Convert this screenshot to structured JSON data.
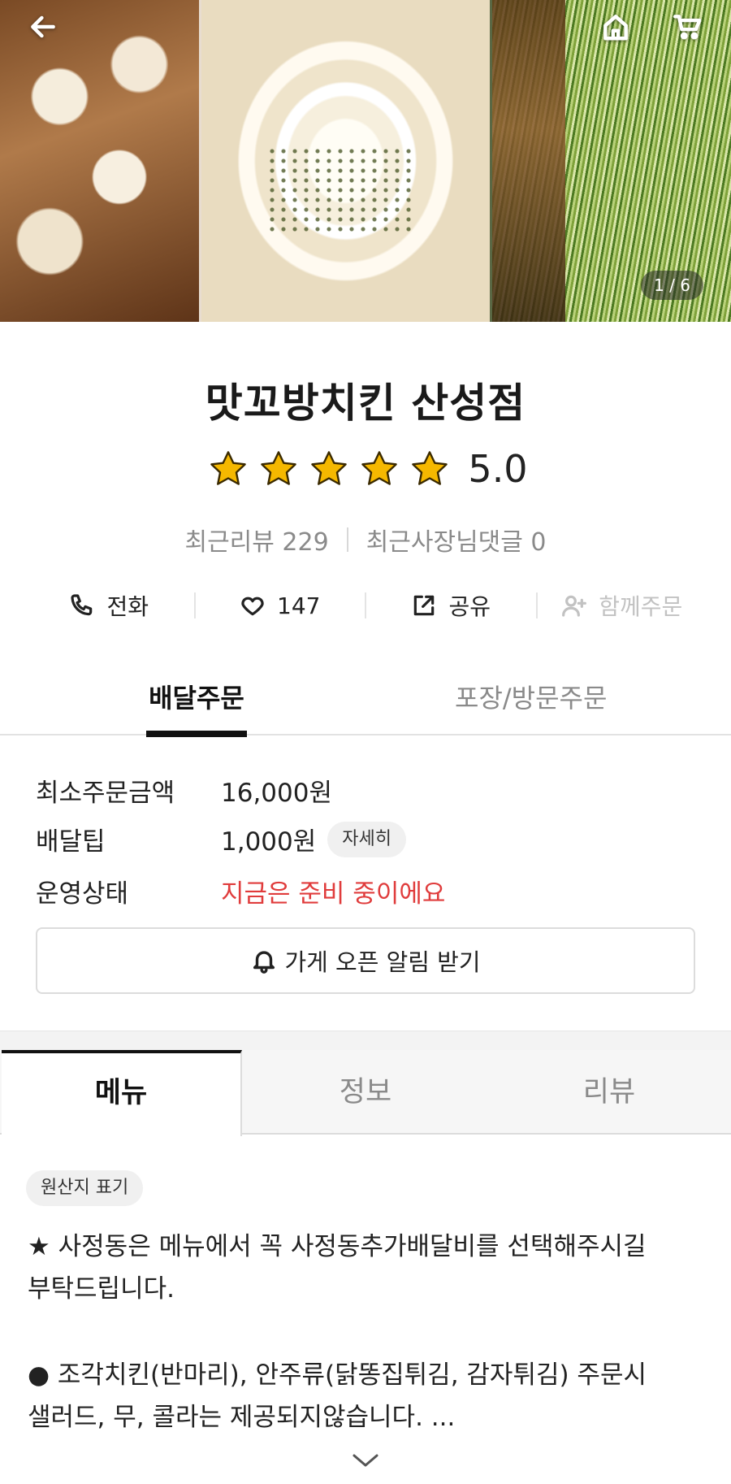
{
  "hero": {
    "image_counter": "1 / 6",
    "back_icon": "arrow-left-icon",
    "home_icon": "home-icon",
    "cart_icon": "cart-icon"
  },
  "store": {
    "name": "맛꼬방치킨 산성점",
    "rating": "5.0",
    "stars": 5,
    "star_color": "#f5b800",
    "recent_reviews": "최근리뷰 229",
    "recent_owner_replies": "최근사장님댓글 0"
  },
  "actions": {
    "call": "전화",
    "like_count": "147",
    "share": "공유",
    "group_order": "함께주문"
  },
  "order_tabs": {
    "delivery": "배달주문",
    "pickup": "포장/방문주문"
  },
  "delivery_info": {
    "min_order_label": "최소주문금액",
    "min_order_value": "16,000원",
    "tip_label": "배달팁",
    "tip_value": "1,000원",
    "tip_detail": "자세히",
    "status_label": "운영상태",
    "status_value": "지금은 준비 중이에요",
    "status_color": "#e03c3c",
    "notify_button": "가게 오픈 알림 받기"
  },
  "content_tabs": {
    "menu": "메뉴",
    "info": "정보",
    "review": "리뷰"
  },
  "notice": {
    "origin_chip": "원산지 표기",
    "line1": "★ 사정동은 메뉴에서 꼭 사정동추가배달비를 선택해주시길\n부탁드립니다.",
    "line2": "● 조각치킨(반마리), 안주류(닭똥집튀김, 감자튀김) 주문시\n  샐러드, 무, 콜라는 제공되지않습니다. ..."
  }
}
